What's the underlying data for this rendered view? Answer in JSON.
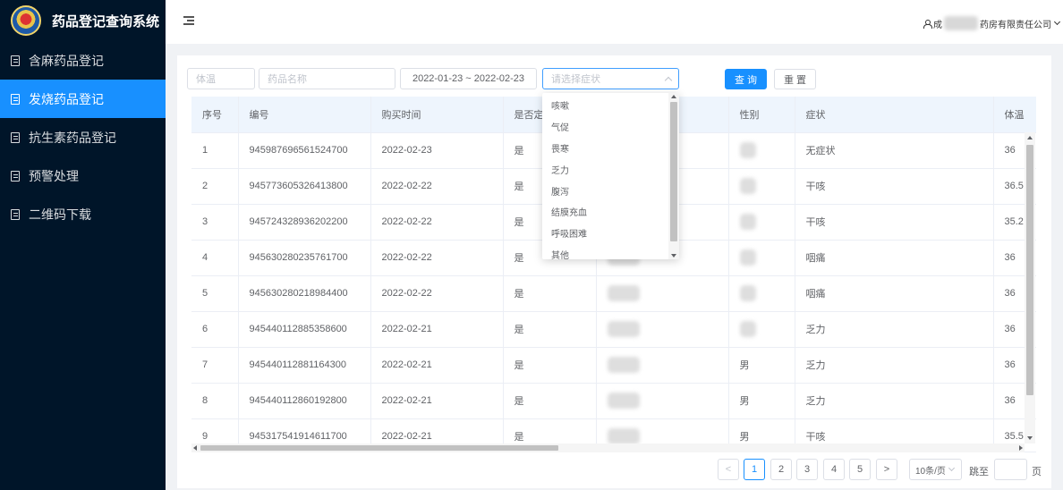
{
  "app": {
    "title": "药品登记查询系统"
  },
  "sidebar": {
    "items": [
      {
        "label": "含麻药品登记",
        "active": false
      },
      {
        "label": "发烧药品登记",
        "active": true
      },
      {
        "label": "抗生素药品登记",
        "active": false
      },
      {
        "label": "预警处理",
        "active": false
      },
      {
        "label": "二维码下载",
        "active": false
      }
    ]
  },
  "header": {
    "user_prefix": "成",
    "user_suffix": "药房有限责任公司"
  },
  "filters": {
    "temp_placeholder": "体温",
    "name_placeholder": "药品名称",
    "date_range": "2022-01-23 ~ 2022-02-23",
    "symptom_placeholder": "请选择症状",
    "search_label": "查 询",
    "reset_label": "重 置"
  },
  "table": {
    "columns": [
      "序号",
      "编号",
      "购买时间",
      "是否定",
      "",
      "性别",
      "症状",
      "体温"
    ],
    "rows": [
      {
        "index": "1",
        "code": "945987696561524700",
        "time": "2022-02-23",
        "flag": "是",
        "gender": "",
        "symptom": "无症状",
        "temp": "36"
      },
      {
        "index": "2",
        "code": "945773605326413800",
        "time": "2022-02-22",
        "flag": "是",
        "gender": "",
        "symptom": "干咳",
        "temp": "36.5"
      },
      {
        "index": "3",
        "code": "945724328936202200",
        "time": "2022-02-22",
        "flag": "是",
        "gender": "",
        "symptom": "干咳",
        "temp": "35.2"
      },
      {
        "index": "4",
        "code": "945630280235761700",
        "time": "2022-02-22",
        "flag": "是",
        "gender": "",
        "symptom": "咽痛",
        "temp": "36"
      },
      {
        "index": "5",
        "code": "945630280218984400",
        "time": "2022-02-22",
        "flag": "是",
        "gender": "",
        "symptom": "咽痛",
        "temp": "36"
      },
      {
        "index": "6",
        "code": "945440112885358600",
        "time": "2022-02-21",
        "flag": "是",
        "gender": "",
        "symptom": "乏力",
        "temp": "36"
      },
      {
        "index": "7",
        "code": "945440112881164300",
        "time": "2022-02-21",
        "flag": "是",
        "gender": "男",
        "symptom": "乏力",
        "temp": "36"
      },
      {
        "index": "8",
        "code": "945440112860192800",
        "time": "2022-02-21",
        "flag": "是",
        "gender": "男",
        "symptom": "乏力",
        "temp": "36"
      },
      {
        "index": "9",
        "code": "945317541914611700",
        "time": "2022-02-21",
        "flag": "是",
        "gender": "男",
        "symptom": "干咳",
        "temp": "35.5"
      }
    ]
  },
  "dropdown": {
    "options": [
      "咳嗽",
      "气促",
      "畏寒",
      "乏力",
      "腹泻",
      "结膜充血",
      "呼吸困难",
      "其他"
    ]
  },
  "pagination": {
    "pages": [
      "1",
      "2",
      "3",
      "4",
      "5"
    ],
    "current_page": "1",
    "prev_label": "<",
    "next_label": ">",
    "page_size": "10条/页",
    "jump_label": "跳至",
    "jump_suffix": "页"
  },
  "colors": {
    "sidebar_bg": "#001529",
    "accent": "#1890ff",
    "table_header_bg": "#eef5fd"
  }
}
